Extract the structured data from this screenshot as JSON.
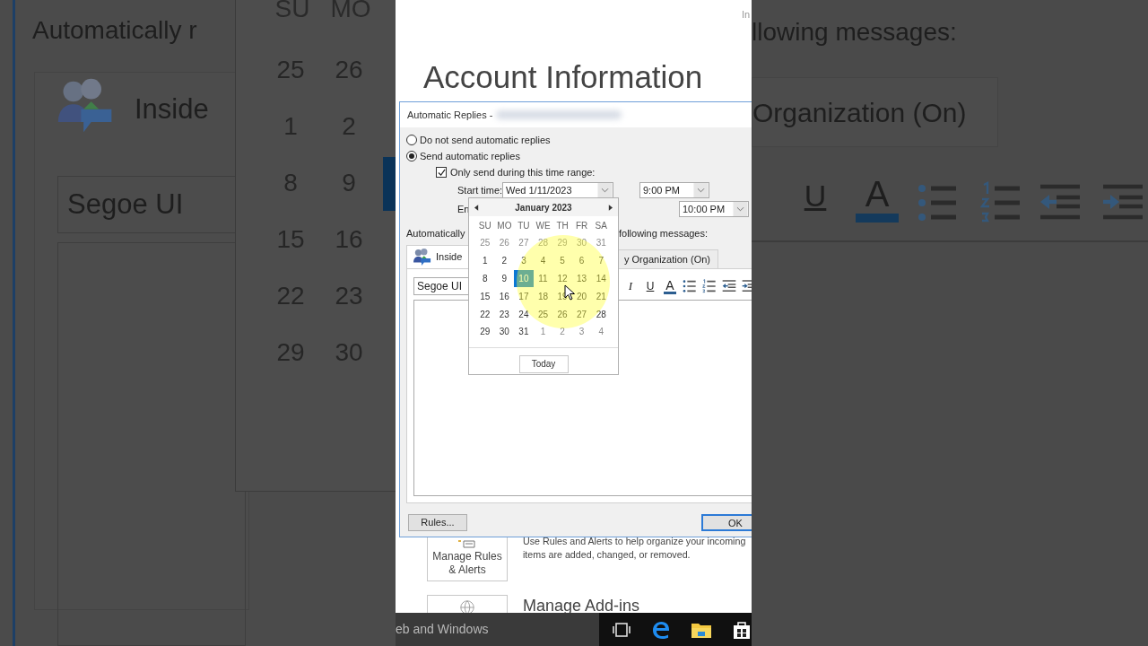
{
  "backdrop_left": {
    "heading": "Automatically r",
    "tab": "Inside",
    "font": "Segoe UI",
    "day_headers": [
      "SU",
      "MO"
    ],
    "weeks": [
      [
        "25",
        "26"
      ],
      [
        "1",
        "2"
      ],
      [
        "8",
        "9"
      ],
      [
        "15",
        "16"
      ],
      [
        "22",
        "23"
      ],
      [
        "29",
        "30"
      ]
    ]
  },
  "backdrop_right": {
    "heading": "llowing messages:",
    "tab": "Organization (On)",
    "toolbar": [
      "U",
      "A"
    ]
  },
  "corner_text": "In",
  "page_title": "Account Information",
  "dialog": {
    "title": "Automatic Replies -",
    "options": [
      {
        "label": "Do not send automatic replies",
        "selected": false
      },
      {
        "label": "Send automatic replies",
        "selected": true
      }
    ],
    "time_range": {
      "label": "Only send during this time range:",
      "checked": true
    },
    "start": {
      "label": "Start time:",
      "date": "Wed 1/11/2023",
      "time": "9:00 PM"
    },
    "end": {
      "label": "En",
      "time": "10:00 PM"
    },
    "reply_label_left": "Automatically",
    "reply_label_right": "following messages:",
    "tabs": [
      {
        "label": "Inside",
        "selected": true
      },
      {
        "label": "y Organization (On)",
        "selected": false
      }
    ],
    "font": "Segoe UI",
    "format_buttons": [
      {
        "kind": "italic",
        "label": "I"
      },
      {
        "kind": "underline",
        "label": "U"
      },
      {
        "kind": "color",
        "label": "A"
      },
      {
        "kind": "bullets"
      },
      {
        "kind": "numbering"
      },
      {
        "kind": "outdent"
      },
      {
        "kind": "indent"
      }
    ],
    "rules_button": "Rules...",
    "ok_button": "OK"
  },
  "calendar": {
    "month": "January 2023",
    "day_headers": [
      "SU",
      "MO",
      "TU",
      "WE",
      "TH",
      "FR",
      "SA"
    ],
    "weeks": [
      [
        {
          "day": "25",
          "other_month": true,
          "selected": false
        },
        {
          "day": "26",
          "other_month": true,
          "selected": false
        },
        {
          "day": "27",
          "other_month": true,
          "selected": false
        },
        {
          "day": "28",
          "other_month": true,
          "selected": false
        },
        {
          "day": "29",
          "other_month": true,
          "selected": false
        },
        {
          "day": "30",
          "other_month": true,
          "selected": false
        },
        {
          "day": "31",
          "other_month": true,
          "selected": false
        }
      ],
      [
        {
          "day": "1",
          "other_month": false,
          "selected": false
        },
        {
          "day": "2",
          "other_month": false,
          "selected": false
        },
        {
          "day": "3",
          "other_month": false,
          "selected": false
        },
        {
          "day": "4",
          "other_month": false,
          "selected": false
        },
        {
          "day": "5",
          "other_month": false,
          "selected": false
        },
        {
          "day": "6",
          "other_month": false,
          "selected": false
        },
        {
          "day": "7",
          "other_month": false,
          "selected": false
        }
      ],
      [
        {
          "day": "8",
          "other_month": false,
          "selected": false
        },
        {
          "day": "9",
          "other_month": false,
          "selected": false
        },
        {
          "day": "10",
          "other_month": false,
          "selected": true
        },
        {
          "day": "11",
          "other_month": false,
          "selected": false
        },
        {
          "day": "12",
          "other_month": false,
          "selected": false
        },
        {
          "day": "13",
          "other_month": false,
          "selected": false
        },
        {
          "day": "14",
          "other_month": false,
          "selected": false
        }
      ],
      [
        {
          "day": "15",
          "other_month": false,
          "selected": false
        },
        {
          "day": "16",
          "other_month": false,
          "selected": false
        },
        {
          "day": "17",
          "other_month": false,
          "selected": false
        },
        {
          "day": "18",
          "other_month": false,
          "selected": false
        },
        {
          "day": "19",
          "other_month": false,
          "selected": false
        },
        {
          "day": "20",
          "other_month": false,
          "selected": false
        },
        {
          "day": "21",
          "other_month": false,
          "selected": false
        }
      ],
      [
        {
          "day": "22",
          "other_month": false,
          "selected": false
        },
        {
          "day": "23",
          "other_month": false,
          "selected": false
        },
        {
          "day": "24",
          "other_month": false,
          "selected": false
        },
        {
          "day": "25",
          "other_month": false,
          "selected": false
        },
        {
          "day": "26",
          "other_month": false,
          "selected": false
        },
        {
          "day": "27",
          "other_month": false,
          "selected": false
        },
        {
          "day": "28",
          "other_month": false,
          "selected": false
        }
      ],
      [
        {
          "day": "29",
          "other_month": false,
          "selected": false
        },
        {
          "day": "30",
          "other_month": false,
          "selected": false
        },
        {
          "day": "31",
          "other_month": false,
          "selected": false
        },
        {
          "day": "1",
          "other_month": true,
          "selected": false
        },
        {
          "day": "2",
          "other_month": true,
          "selected": false
        },
        {
          "day": "3",
          "other_month": true,
          "selected": false
        },
        {
          "day": "4",
          "other_month": true,
          "selected": false
        }
      ]
    ],
    "today_button": "Today"
  },
  "backstage": {
    "rules_tile": "Manage Rules & Alerts",
    "rules_description": [
      "Use Rules and Alerts to help organize your incoming",
      "items are added, changed, or removed."
    ],
    "addins_title": "Manage Add-ins"
  },
  "taskbar": {
    "search_text": "eb and Windows"
  }
}
